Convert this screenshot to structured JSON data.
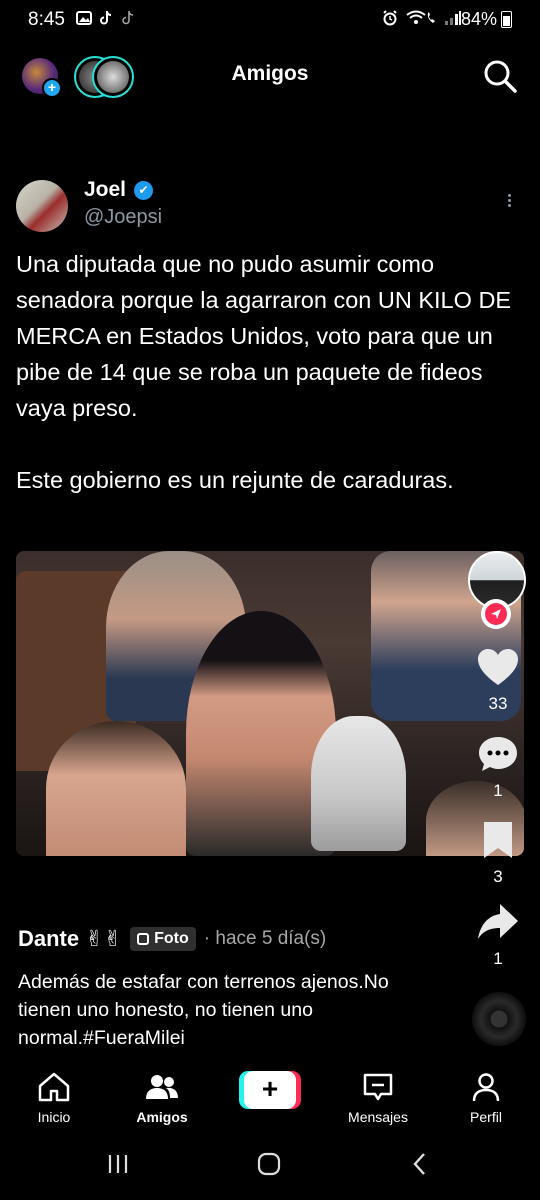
{
  "status_bar": {
    "time": "8:45",
    "battery": "84%",
    "icons": [
      "gallery-icon",
      "tiktok-icon",
      "tiktok-icon",
      "alarm-icon",
      "wifi-call-icon",
      "signal-icon",
      "battery-icon"
    ]
  },
  "top_nav": {
    "title": "Amigos",
    "add_story_symbol": "+",
    "icons": [
      "my-avatar",
      "friends-stories",
      "search-icon"
    ]
  },
  "post": {
    "author_name": "Joel",
    "author_handle": "@Joepsi",
    "verified": true,
    "paragraph1": "Una diputada que no pudo asumir como senadora porque la agarraron con UN KILO DE MERCA en Estados Unidos, voto para que un pibe de 14 que se roba un paquete de fideos vaya preso.",
    "paragraph2": "Este gobierno es un rejunte de caraduras."
  },
  "actions": {
    "likes": "33",
    "comments": "1",
    "saves": "3",
    "shares": "1"
  },
  "caption": {
    "username": "Dante ✌✌",
    "badge": "Foto",
    "time": "· hace 5 día(s)",
    "text": "Además de estafar con terrenos ajenos.No tienen uno honesto, no tienen uno normal.#FueraMilei"
  },
  "bottom_nav": {
    "home": "Inicio",
    "friends": "Amigos",
    "create": "+",
    "messages": "Mensajes",
    "profile": "Perfil"
  },
  "colors": {
    "accent_cyan": "#25f4ee",
    "accent_red": "#fe2c55",
    "verified_blue": "#1d9bf0",
    "background": "#000000"
  }
}
